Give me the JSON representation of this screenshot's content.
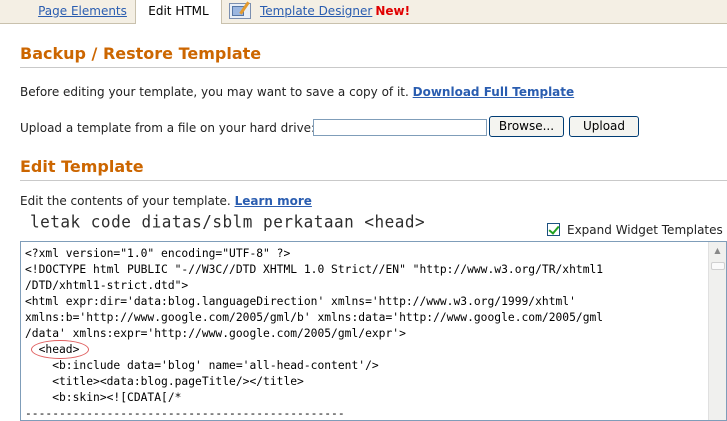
{
  "tabs": {
    "page_elements": "Page Elements",
    "edit_html": "Edit HTML",
    "template_designer": "Template Designer",
    "new_badge": "New!"
  },
  "backup": {
    "heading": "Backup / Restore Template",
    "intro": "Before editing your template, you may want to save a copy of it.",
    "download_link": "Download Full Template",
    "upload_prompt": "Upload a template from a file on your hard drive:",
    "upload_value": "",
    "browse_button": "Browse...",
    "upload_button": "Upload"
  },
  "edit": {
    "heading": "Edit Template",
    "intro": "Edit the contents of your template.",
    "learn_more": "Learn more",
    "annotation": "letak code diatas/sblm perkataan <head>",
    "expand_widgets_label": "Expand Widget Templates",
    "expand_widgets_checked": true
  },
  "code_lines": [
    "<?xml version=\"1.0\" encoding=\"UTF-8\" ?>",
    "<!DOCTYPE html PUBLIC \"-//W3C//DTD XHTML 1.0 Strict//EN\" \"http://www.w3.org/TR/xhtml1",
    "/DTD/xhtml1-strict.dtd\">",
    "<html expr:dir='data:blog.languageDirection' xmlns='http://www.w3.org/1999/xhtml'",
    "xmlns:b='http://www.google.com/2005/gml/b' xmlns:data='http://www.google.com/2005/gml",
    "/data' xmlns:expr='http://www.google.com/2005/gml/expr'>",
    "  <head>",
    "    <b:include data='blog' name='all-head-content'/>",
    "    <title><data:blog.pageTitle/></title>",
    "    <b:skin><![CDATA[/*",
    "-----------------------------------------------"
  ]
}
